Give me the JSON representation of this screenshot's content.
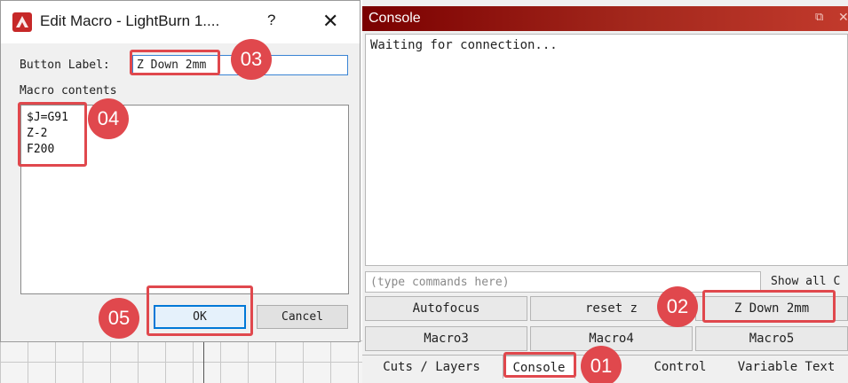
{
  "dialog": {
    "title": "Edit Macro - LightBurn 1....",
    "help": "?",
    "close": "✕",
    "button_label_caption": "Button Label:",
    "button_label_value": "Z Down 2mm",
    "macro_contents_caption": "Macro contents",
    "macro_lines": [
      "$J=G91",
      "Z-2",
      "F200"
    ],
    "ok": "OK",
    "cancel": "Cancel"
  },
  "console": {
    "title": "Console",
    "float_icon": "⧉",
    "close_icon": "✕",
    "output": "Waiting for connection...",
    "command_placeholder": "(type commands here)",
    "show_all": "Show all C",
    "macro_buttons_row1": [
      "Autofocus",
      "reset z",
      "Z Down 2mm"
    ],
    "macro_buttons_row2": [
      "Macro3",
      "Macro4",
      "Macro5"
    ],
    "tabs": [
      "Cuts / Layers",
      "Console",
      "Control",
      "Variable Text"
    ]
  },
  "annotations": {
    "step1": "01",
    "step2": "02",
    "step3": "03",
    "step4": "04",
    "step5": "05",
    "color": "#e0484d"
  }
}
